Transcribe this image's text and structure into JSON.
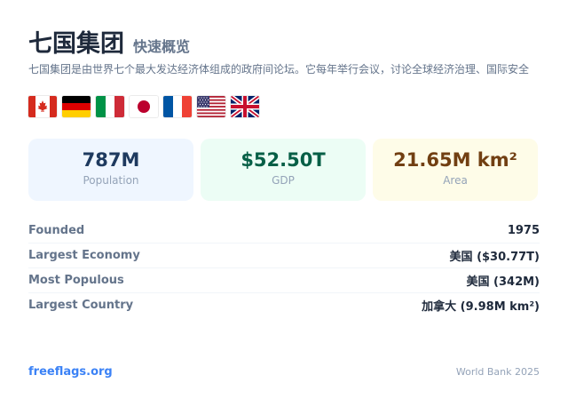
{
  "header": {
    "title": "七国集团",
    "subtitle": "快速概览",
    "description": "七国集团是由世界七个最大发达经济体组成的政府间论坛。它每年举行会议，讨论全球经济治理、国际安全"
  },
  "flags": [
    {
      "name": "canada-flag-icon"
    },
    {
      "name": "germany-flag-icon"
    },
    {
      "name": "italy-flag-icon"
    },
    {
      "name": "japan-flag-icon"
    },
    {
      "name": "france-flag-icon"
    },
    {
      "name": "usa-flag-icon"
    },
    {
      "name": "uk-flag-icon"
    }
  ],
  "stats": {
    "population": {
      "value": "787M",
      "label": "Population",
      "color": "#1e3a5f",
      "bg": "#eff6ff"
    },
    "gdp": {
      "value": "$52.50T",
      "label": "GDP",
      "color": "#065f46",
      "bg": "#ecfdf5"
    },
    "area": {
      "value": "21.65M km²",
      "label": "Area",
      "color": "#713f12",
      "bg": "#fefce8"
    }
  },
  "facts": [
    {
      "label": "Founded",
      "value": "1975"
    },
    {
      "label": "Largest Economy",
      "value": "美国 ($30.77T)"
    },
    {
      "label": "Most Populous",
      "value": "美国 (342M)"
    },
    {
      "label": "Largest Country",
      "value": "加拿大 (9.98M km²)"
    }
  ],
  "footer": {
    "link": "freeflags.org",
    "source": "World Bank 2025",
    "link_color": "#3b82f6"
  }
}
